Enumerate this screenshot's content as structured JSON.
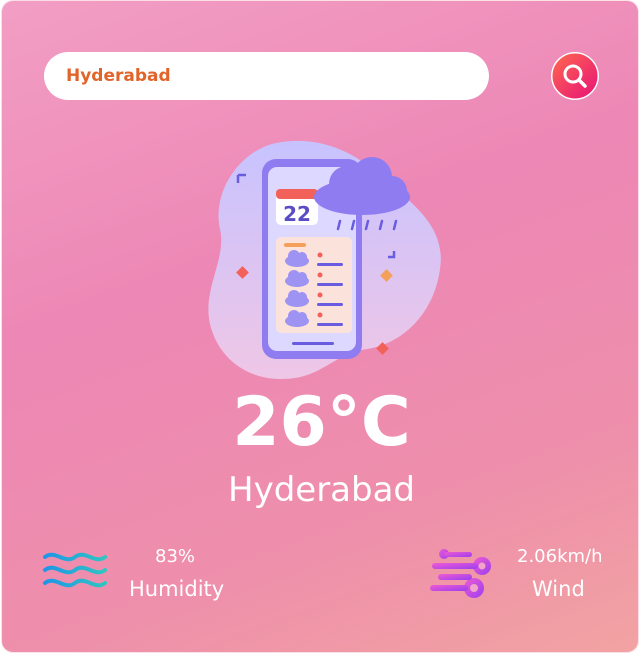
{
  "search": {
    "value": "Hyderabad",
    "icon": "search-icon"
  },
  "weather": {
    "temperature": "26°C",
    "city": "Hyderabad",
    "calendar_day": "22",
    "illustration_icon": "phone-weather-illustration"
  },
  "stats": {
    "humidity": {
      "value": "83%",
      "label": "Humidity",
      "icon": "humidity-waves-icon"
    },
    "wind": {
      "value": "2.06km/h",
      "label": "Wind",
      "icon": "wind-icon"
    }
  },
  "colors": {
    "accent": "#e1642a",
    "search_button": "#f0336e",
    "background_top": "#f29ec4",
    "background_bottom": "#f2a3a2"
  }
}
